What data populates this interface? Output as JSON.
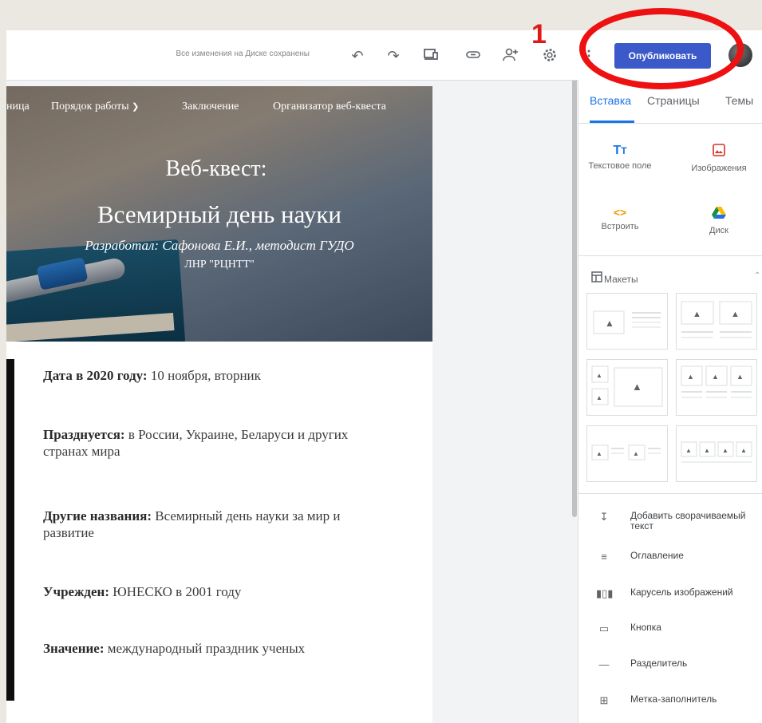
{
  "toolbar": {
    "save_status": "Все изменения на Диске сохранены",
    "publish_label": "Опубликовать",
    "icons": [
      "undo-icon",
      "redo-icon",
      "device-preview-icon",
      "link-icon",
      "share-icon",
      "settings-icon",
      "more-icon"
    ]
  },
  "annotation": {
    "number": "1"
  },
  "site": {
    "nav": [
      "ница",
      "Порядок работы",
      "Заключение",
      "Организатор веб-квеста"
    ],
    "title_line1": "Веб-квест:",
    "title_line2": "Всемирный день науки",
    "subtitle_line1": "Разработал: Сафонова Е.И., методист ГУДО",
    "subtitle_line2": "ЛНР \"РЦНТТ\"",
    "facts": [
      {
        "label": "Дата в 2020 году:",
        "value": " 10 ноября, вторник"
      },
      {
        "label": "Празднуется:",
        "value": " в России, Украине, Беларуси и других странах мира"
      },
      {
        "label": "Другие названия:",
        "value": " Всемирный день науки за мир и развитие"
      },
      {
        "label": "Учрежден:",
        "value": " ЮНЕСКО в 2001 году"
      },
      {
        "label": "Значение:",
        "value": " международный праздник ученых"
      }
    ]
  },
  "panel": {
    "tabs": [
      "Вставка",
      "Страницы",
      "Темы"
    ],
    "insert_items": [
      {
        "label": "Текстовое поле",
        "icon": "text-box-icon"
      },
      {
        "label": "Изображения",
        "icon": "image-icon"
      },
      {
        "label": "Встроить",
        "icon": "embed-icon"
      },
      {
        "label": "Диск",
        "icon": "drive-icon"
      }
    ],
    "layouts_label": "Макеты",
    "elements": [
      {
        "label": "Добавить сворачиваемый текст",
        "icon": "collapsible-text-icon"
      },
      {
        "label": "Оглавление",
        "icon": "table-of-contents-icon"
      },
      {
        "label": "Карусель изображений",
        "icon": "image-carousel-icon"
      },
      {
        "label": "Кнопка",
        "icon": "button-icon"
      },
      {
        "label": "Разделитель",
        "icon": "divider-icon"
      },
      {
        "label": "Метка-заполнитель",
        "icon": "placeholder-icon"
      }
    ],
    "active_tab_color": "#1a73e8",
    "publish_color": "#3c59c9"
  }
}
